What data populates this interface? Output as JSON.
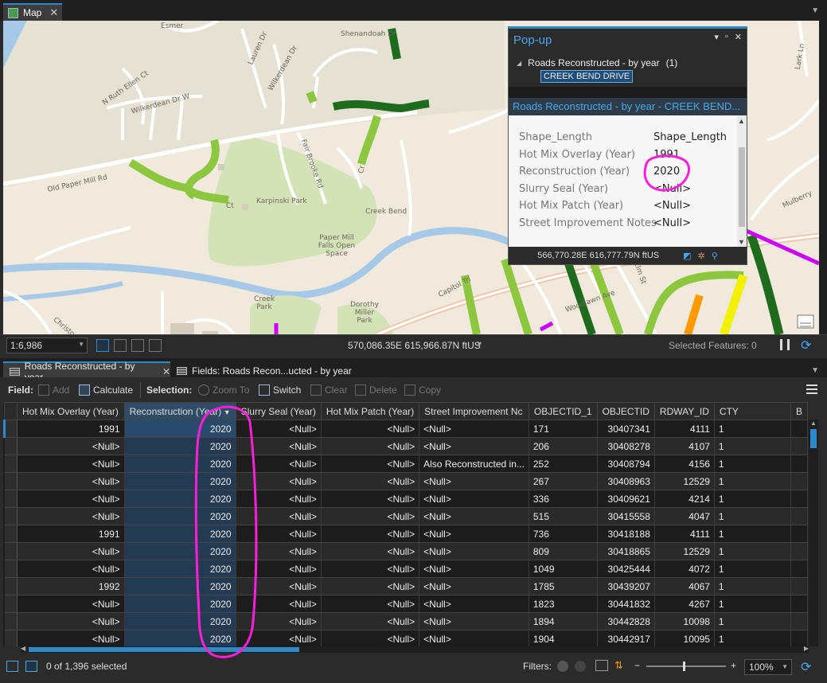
{
  "map_tab": {
    "label": "Map",
    "close": "✕"
  },
  "map_labels": [
    "Esmer",
    "Shenandoah Dr",
    "Lauren Dr",
    "Wilkerdean Dr",
    "N Ruth Ellen Ct",
    "Wilkerdean Dr W",
    "Old Paper Mill Rd",
    "Fair Brooke Rd",
    "Ct",
    "Karpinski Park",
    "Creek Bend",
    "Paper Mill Falls Open Space",
    "Creek Park",
    "Dorothy Miller Park",
    "Capitol Trl",
    "Woodlawn Ave",
    "Elm St",
    "Mulberry",
    "Cr",
    "Christo",
    "Lark Ln"
  ],
  "popup": {
    "title": "Pop-up",
    "layer_label": "Roads Reconstructed - by year",
    "layer_count": "(1)",
    "feature": "CREEK BEND DRIVE",
    "feature_title": "Roads Reconstructed - by year - CREEK BEND...",
    "fields": [
      {
        "name": "Shape_Length",
        "value": "Shape_Length"
      },
      {
        "name": "Hot Mix Overlay (Year)",
        "value": "1991"
      },
      {
        "name": "Reconstruction (Year)",
        "value": "2020"
      },
      {
        "name": "Slurry Seal (Year)",
        "value": "<Null>"
      },
      {
        "name": "Hot Mix Patch (Year)",
        "value": "<Null>"
      },
      {
        "name": "Street Improvement Notes",
        "value": "<Null>"
      }
    ],
    "coordinates": "566,770.28E 616,777.79N ftUS"
  },
  "map_status": {
    "scale": "1:6,986",
    "coordinates": "570,086.35E 615,966.87N ftUS",
    "selected_features": "Selected Features: 0"
  },
  "attr_tabs": [
    {
      "label": "Roads Reconstructed - by year",
      "close": "✕"
    },
    {
      "label": "Fields:  Roads Recon...ucted - by year"
    }
  ],
  "toolbar": {
    "field_label": "Field:",
    "add": "Add",
    "calculate": "Calculate",
    "selection_label": "Selection:",
    "zoom_to": "Zoom To",
    "switch": "Switch",
    "clear": "Clear",
    "delete": "Delete",
    "copy": "Copy"
  },
  "table": {
    "columns": [
      "Hot Mix Overlay (Year)",
      "Reconstruction (Year)",
      "Slurry Seal (Year)",
      "Hot Mix Patch (Year)",
      "Street Improvement Nc",
      "OBJECTID_1",
      "OBJECTID",
      "RDWAY_ID",
      "CTY",
      "B"
    ],
    "rows": [
      [
        "1991",
        "2020",
        "<Null>",
        "<Null>",
        "<Null>",
        "171",
        "30407341",
        "4111",
        "1"
      ],
      [
        "<Null>",
        "2020",
        "<Null>",
        "<Null>",
        "<Null>",
        "206",
        "30408278",
        "4107",
        "1"
      ],
      [
        "<Null>",
        "2020",
        "<Null>",
        "<Null>",
        "Also Reconstructed in...",
        "252",
        "30408794",
        "4156",
        "1"
      ],
      [
        "<Null>",
        "2020",
        "<Null>",
        "<Null>",
        "<Null>",
        "267",
        "30408963",
        "12529",
        "1"
      ],
      [
        "<Null>",
        "2020",
        "<Null>",
        "<Null>",
        "<Null>",
        "336",
        "30409621",
        "4214",
        "1"
      ],
      [
        "<Null>",
        "2020",
        "<Null>",
        "<Null>",
        "<Null>",
        "515",
        "30415558",
        "4047",
        "1"
      ],
      [
        "1991",
        "2020",
        "<Null>",
        "<Null>",
        "<Null>",
        "736",
        "30418188",
        "4111",
        "1"
      ],
      [
        "<Null>",
        "2020",
        "<Null>",
        "<Null>",
        "<Null>",
        "809",
        "30418865",
        "12529",
        "1"
      ],
      [
        "<Null>",
        "2020",
        "<Null>",
        "<Null>",
        "<Null>",
        "1049",
        "30425444",
        "4072",
        "1"
      ],
      [
        "1992",
        "2020",
        "<Null>",
        "<Null>",
        "<Null>",
        "1785",
        "30439207",
        "4067",
        "1"
      ],
      [
        "<Null>",
        "2020",
        "<Null>",
        "<Null>",
        "<Null>",
        "1823",
        "30441832",
        "4267",
        "1"
      ],
      [
        "<Null>",
        "2020",
        "<Null>",
        "<Null>",
        "<Null>",
        "1894",
        "30442828",
        "10098",
        "1"
      ],
      [
        "<Null>",
        "2020",
        "<Null>",
        "<Null>",
        "<Null>",
        "1904",
        "30442917",
        "10095",
        "1"
      ]
    ]
  },
  "bottom": {
    "selected": "0 of 1,396 selected",
    "filters": "Filters:",
    "zoom": "100%",
    "minus": "−",
    "plus": "+"
  },
  "colors": {
    "accent": "#2d89c8",
    "road_light": "#8dc63f",
    "road_mid": "#5a9e1f",
    "road_dark": "#1e6b1e",
    "road_magenta": "#cc00ff",
    "road_orange": "#ff9900",
    "road_yellow": "#f2f200",
    "annotation": "#ff1fd8"
  }
}
